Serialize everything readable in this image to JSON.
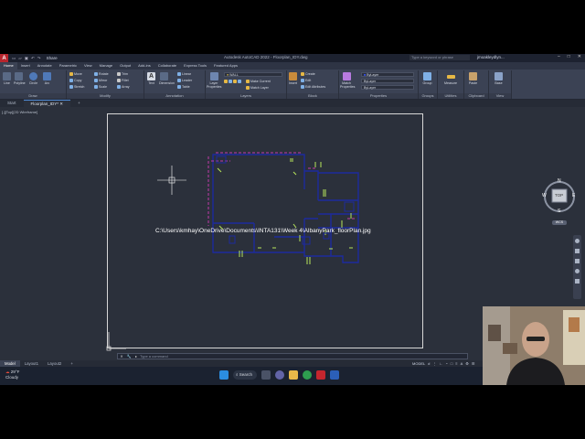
{
  "app": {
    "logo_letter": "A",
    "title": "Autodesk AutoCAD 2022 - Floorplan_IDY.dwg",
    "share_label": "Share",
    "search_placeholder": "Type a keyword or phrase",
    "user": "jmoakleydlyn..."
  },
  "ribbon_tabs": [
    "Home",
    "Insert",
    "Annotate",
    "Parametric",
    "View",
    "Manage",
    "Output",
    "Add-ins",
    "Collaborate",
    "Express Tools",
    "Featured Apps"
  ],
  "ribbon_groups": {
    "draw": {
      "title": "Draw",
      "tools": [
        "Line",
        "Polyline",
        "Circle",
        "Arc"
      ]
    },
    "modify": {
      "title": "Modify",
      "tools": [
        "Move",
        "Rotate",
        "Trim",
        "Copy",
        "Mirror",
        "Fillet",
        "Stretch",
        "Scale",
        "Array"
      ]
    },
    "annotation": {
      "title": "Annotation",
      "tools": [
        "Text",
        "Dimension",
        "Linear",
        "Leader",
        "Table"
      ]
    },
    "layers": {
      "title": "Layers",
      "tools": [
        "Layer Properties",
        "Make Current",
        "Match Layer"
      ],
      "current_layer": "WALL"
    },
    "block": {
      "title": "Block",
      "tools": [
        "Insert",
        "Create",
        "Edit",
        "Edit Attributes"
      ]
    },
    "properties": {
      "title": "Properties",
      "tools": [
        "Match Properties"
      ],
      "values": [
        "ByLayer",
        "ByLayer",
        "ByLayer"
      ]
    },
    "groups": {
      "title": "Groups",
      "tools": [
        "Group"
      ]
    },
    "utilities": {
      "title": "Utilities",
      "tools": [
        "Measure"
      ]
    },
    "clipboard": {
      "title": "Clipboard",
      "tools": [
        "Paste"
      ]
    },
    "view": {
      "title": "View",
      "tools": [
        "Base"
      ]
    }
  },
  "file_tabs": [
    "Start",
    "Floorplan_IDY*"
  ],
  "viewport_label": "[-][Top][2D Wireframe]",
  "drawing": {
    "image_path_text": "C:\\Users\\kmhay\\OneDrive\\Documents\\INTA131\\Week 4\\AlbanyPark_floorPlan.jpg",
    "line_color": "#1d2a9e",
    "dash_color": "#c23aa8",
    "dim_color": "#b7e65b"
  },
  "viewcube": {
    "top_label": "TOP",
    "n": "N",
    "s": "S",
    "e": "E",
    "w": "W",
    "wcs": "WCS"
  },
  "command_line": {
    "placeholder": "Type a command"
  },
  "layout_tabs": [
    "Model",
    "Layout1",
    "Layout2"
  ],
  "status": {
    "model_label": "MODEL"
  },
  "taskbar": {
    "temp": "29°F",
    "condition": "Cloudy",
    "search_label": "Search"
  }
}
